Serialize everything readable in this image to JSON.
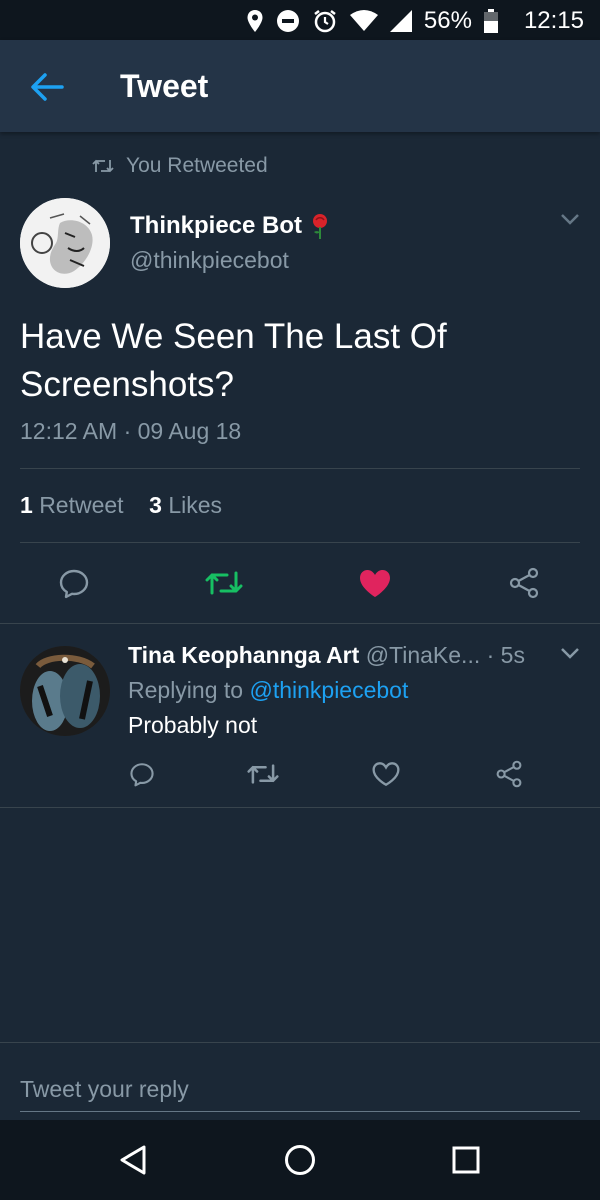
{
  "status_bar": {
    "battery": "56%",
    "time": "12:15",
    "icons": [
      "location-icon",
      "do-not-disturb-icon",
      "alarm-icon",
      "wifi-icon",
      "cell-signal-icon",
      "battery-icon"
    ]
  },
  "app_bar": {
    "title": "Tweet",
    "back_icon": "arrow-left-icon"
  },
  "tweet": {
    "retweet_context": "You Retweeted",
    "author_name": "Thinkpiece Bot",
    "author_handle": "@thinkpiecebot",
    "text": "Have We Seen The Last Of Screenshots?",
    "timestamp": "12:12 AM · 09 Aug 18",
    "retweet_count": "1",
    "retweet_label": "Retweet",
    "like_count": "3",
    "like_label": "Likes",
    "colors": {
      "retweeted": "#17bf63",
      "liked": "#e0245e",
      "link": "#1da1f2"
    }
  },
  "reply": {
    "author_name": "Tina Keophannga Art",
    "author_handle": "@TinaKe...",
    "age": "· 5s",
    "replying_prefix": "Replying to",
    "replying_to": "@thinkpiecebot",
    "text": "Probably not"
  },
  "compose": {
    "placeholder": "Tweet your reply"
  },
  "nav": {
    "icons": [
      "back-triangle-icon",
      "home-circle-icon",
      "recents-square-icon"
    ]
  }
}
